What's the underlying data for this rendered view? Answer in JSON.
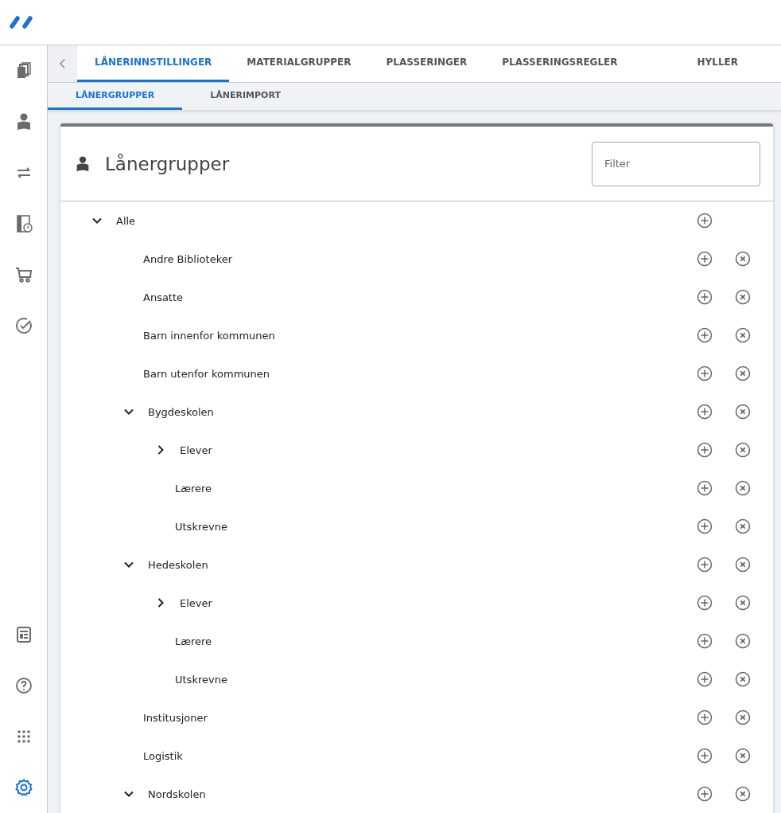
{
  "tabs": [
    {
      "label": "LÅNERINNSTILLINGER",
      "selected": true
    },
    {
      "label": "MATERIALGRUPPER",
      "selected": false
    },
    {
      "label": "PLASSERINGER",
      "selected": false
    },
    {
      "label": "PLASSERINGSREGLER",
      "selected": false
    },
    {
      "label": "HYLLER",
      "selected": false
    }
  ],
  "subtabs": [
    {
      "label": "LÅNERGRUPPER",
      "selected": true
    },
    {
      "label": "LÅNERIMPORT",
      "selected": false
    }
  ],
  "sidebar": {
    "items": [
      {
        "kind": "books",
        "selected": false
      },
      {
        "kind": "reader",
        "selected": false
      },
      {
        "kind": "transfer",
        "selected": false
      },
      {
        "kind": "history",
        "selected": false
      },
      {
        "kind": "cart",
        "selected": false
      },
      {
        "kind": "check",
        "selected": false
      }
    ],
    "bottom_items": [
      {
        "kind": "report",
        "selected": false
      },
      {
        "kind": "help",
        "selected": false
      },
      {
        "kind": "apps",
        "selected": false
      },
      {
        "kind": "settings",
        "selected": true
      }
    ]
  },
  "card": {
    "title": "Lånergrupper",
    "filter": {
      "placeholder": "Filter"
    }
  },
  "tree": [
    {
      "label": "Alle",
      "expanded": true,
      "removable": false,
      "children": [
        {
          "label": "Andre Biblioteker",
          "removable": true
        },
        {
          "label": "Ansatte",
          "removable": true
        },
        {
          "label": "Barn innenfor kommunen",
          "removable": true
        },
        {
          "label": "Barn utenfor kommunen",
          "removable": true
        },
        {
          "label": "Bygdeskolen",
          "expanded": true,
          "removable": true,
          "children": [
            {
              "label": "Elever",
              "expanded": false,
              "removable": true
            },
            {
              "label": "Lærere",
              "removable": true
            },
            {
              "label": "Utskrevne",
              "removable": true
            }
          ]
        },
        {
          "label": "Hedeskolen",
          "expanded": true,
          "removable": true,
          "children": [
            {
              "label": "Elever",
              "expanded": false,
              "removable": true
            },
            {
              "label": "Lærere",
              "removable": true
            },
            {
              "label": "Utskrevne",
              "removable": true
            }
          ]
        },
        {
          "label": "Institusjoner",
          "removable": true
        },
        {
          "label": "Logistik",
          "removable": true
        },
        {
          "label": "Nordskolen",
          "expanded": true,
          "removable": true
        }
      ]
    }
  ]
}
